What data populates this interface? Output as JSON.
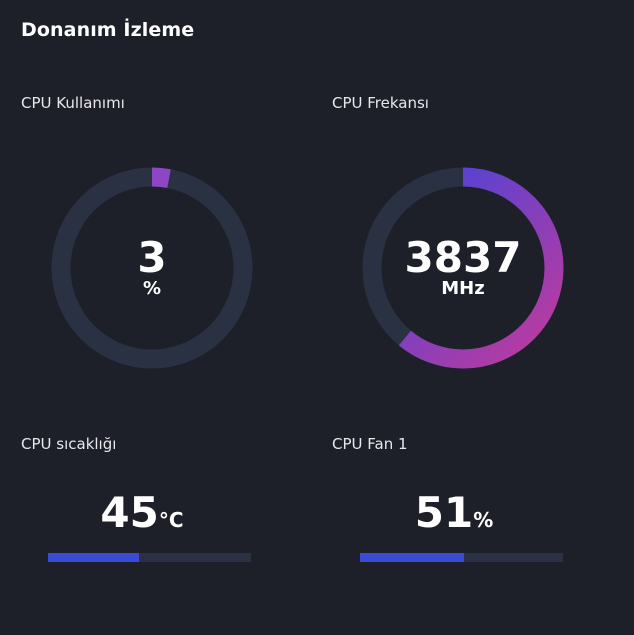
{
  "page": {
    "title": "Donanım İzleme"
  },
  "colors": {
    "background": "#1e2029",
    "track": "#2a3142",
    "bar": "#3a4bd8",
    "gradient_start": "#b83aa6",
    "gradient_end": "#3a45e0"
  },
  "cpu_usage": {
    "label": "CPU Kullanımı",
    "value": "3",
    "unit": "%",
    "fraction": 0.03
  },
  "cpu_frequency": {
    "label": "CPU Frekansı",
    "value": "3837",
    "unit": "MHz",
    "fraction": 0.61
  },
  "cpu_temp": {
    "label": "CPU sıcaklığı",
    "value": "45",
    "unit": "°C",
    "fraction": 0.45
  },
  "cpu_fan": {
    "label": "CPU Fan 1",
    "value": "51",
    "unit": "%",
    "fraction": 0.51
  }
}
